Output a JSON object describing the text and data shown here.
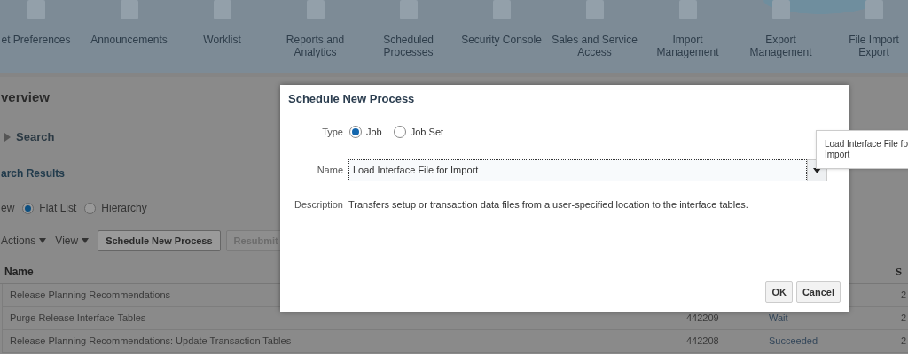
{
  "nav": {
    "items": [
      {
        "lines": [
          "et Preferences"
        ]
      },
      {
        "lines": [
          "Announcements"
        ]
      },
      {
        "lines": [
          "Worklist"
        ]
      },
      {
        "lines": [
          "Reports and",
          "Analytics"
        ]
      },
      {
        "lines": [
          "Scheduled",
          "Processes"
        ]
      },
      {
        "lines": [
          "Security Console"
        ]
      },
      {
        "lines": [
          "Sales and Service",
          "Access"
        ]
      },
      {
        "lines": [
          "Import",
          "Management"
        ]
      },
      {
        "lines": [
          "Export",
          "Management"
        ]
      },
      {
        "lines": [
          "File Import",
          "Export"
        ]
      }
    ]
  },
  "page": {
    "heading": "verview",
    "search": {
      "label": "Search",
      "expanded": false
    },
    "results_title": "arch Results",
    "view": {
      "label": "ew",
      "options": [
        {
          "label": "Flat List",
          "selected": true
        },
        {
          "label": "Hierarchy",
          "selected": false
        }
      ]
    },
    "toolbar": {
      "menus": [
        "Actions",
        "View"
      ],
      "buttons": [
        {
          "label": "Schedule New Process",
          "disabled": false
        },
        {
          "label": "Resubmit",
          "disabled": true
        }
      ]
    },
    "table": {
      "columns": [
        {
          "label": "Name"
        },
        {
          "label": "S"
        }
      ],
      "rows": [
        {
          "name": "Release Planning Recommendations",
          "column_4": "2"
        },
        {
          "name": "Purge Release Interface Tables",
          "column_2": "442209",
          "column_3": "Wait",
          "column_4": "2"
        },
        {
          "name": "Release Planning Recommendations: Update Transaction Tables",
          "column_2": "442208",
          "column_3": "Succeeded",
          "column_4": "2"
        }
      ]
    }
  },
  "dialog": {
    "title": "Schedule New Process",
    "type": {
      "label": "Type",
      "options": [
        {
          "label": "Job",
          "selected": true
        },
        {
          "label": "Job Set",
          "selected": false
        }
      ]
    },
    "name": {
      "label": "Name",
      "value": "Load Interface File for Import"
    },
    "description": {
      "label": "Description",
      "text": "Transfers setup or transaction data files from a user-specified location to the interface tables."
    },
    "buttons": [
      "OK",
      "Cancel"
    ]
  },
  "tooltip": {
    "lines": [
      "Load Interface File fo",
      "Import"
    ]
  }
}
